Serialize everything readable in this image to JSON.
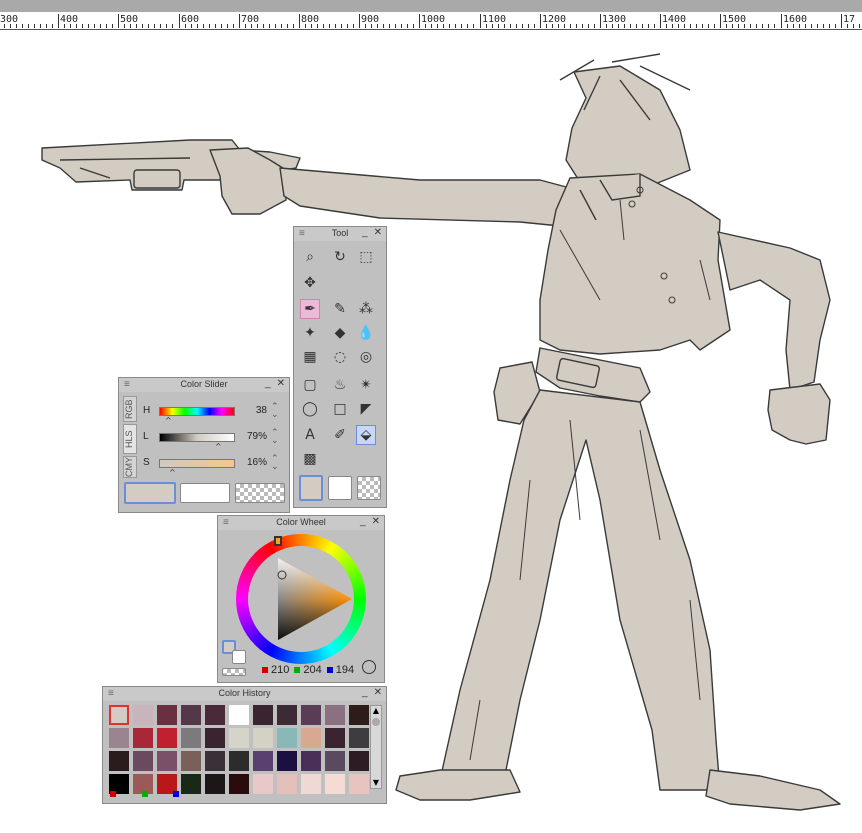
{
  "ruler": {
    "labels": [
      "300",
      "400",
      "500",
      "600",
      "700",
      "800",
      "900",
      "1000",
      "1100",
      "1200",
      "1300",
      "1400",
      "1500",
      "1600",
      "17"
    ]
  },
  "tool_palette": {
    "title": "Tool",
    "tools": [
      {
        "name": "zoom-icon",
        "glyph": "⌕"
      },
      {
        "name": "rotate-view-icon",
        "glyph": "↻"
      },
      {
        "name": "object-select-icon",
        "glyph": "⬚"
      },
      {
        "name": "move-icon",
        "glyph": "✥"
      },
      {
        "name": "pen-icon",
        "glyph": "✒"
      },
      {
        "name": "brush-icon",
        "glyph": "✎"
      },
      {
        "name": "airbrush-icon",
        "glyph": "⁂"
      },
      {
        "name": "decoration-icon",
        "glyph": "✦"
      },
      {
        "name": "eraser-icon",
        "glyph": "◆"
      },
      {
        "name": "blend-icon",
        "glyph": "💧"
      },
      {
        "name": "ruler-tool-icon",
        "glyph": "▦"
      },
      {
        "name": "lasso-icon",
        "glyph": "◌"
      },
      {
        "name": "mesh-icon",
        "glyph": "◎"
      },
      {
        "name": "rect-select-icon",
        "glyph": "▢"
      },
      {
        "name": "cake-icon",
        "glyph": "♨"
      },
      {
        "name": "auto-select-icon",
        "glyph": "✴"
      },
      {
        "name": "ellipse-select-icon",
        "glyph": "◯"
      },
      {
        "name": "frame-icon",
        "glyph": "□"
      },
      {
        "name": "polyline-icon",
        "glyph": "◤"
      },
      {
        "name": "text-icon",
        "glyph": "A"
      },
      {
        "name": "eyedropper-icon",
        "glyph": "✐"
      },
      {
        "name": "fill-icon",
        "glyph": "⬙"
      },
      {
        "name": "gradient-icon",
        "glyph": "▩"
      }
    ]
  },
  "color_slider": {
    "title": "Color Slider",
    "tabs": [
      "RGB",
      "HLS",
      "CMY"
    ],
    "rows": [
      {
        "label": "H",
        "value": "38"
      },
      {
        "label": "L",
        "value": "79%"
      },
      {
        "label": "S",
        "value": "16%"
      }
    ]
  },
  "color_wheel": {
    "title": "Color Wheel",
    "r": "210",
    "g": "204",
    "b": "194"
  },
  "color_history": {
    "title": "Color History",
    "swatches": [
      "#d2ccc2",
      "#c9b3bd",
      "#6a3040",
      "#54384a",
      "#4a2a38",
      "#ffffff",
      "#3a2430",
      "#3c2a34",
      "#5a3c56",
      "#8a7080",
      "#2e1c18",
      "#9a8490",
      "#a82838",
      "#c02030",
      "#7c7a7c",
      "#3a2430",
      "#d4d4c8",
      "#d4d2c4",
      "#8ab8b8",
      "#d8a890",
      "#3a2430",
      "#3e3c3e",
      "#2a1c1c",
      "#6a4a5e",
      "#7a5068",
      "#7a6058",
      "#3a3038",
      "#2c2c2c",
      "#5a4070",
      "#1c1040",
      "#4a3058",
      "#5a4a60",
      "#2e1c24",
      "#000000",
      "#9a5a58",
      "#b81818",
      "#1a2818",
      "#1c1618",
      "#2a0c0c",
      "#e8c8c8",
      "#e4c0bc",
      "#f0d8d4",
      "#f4dcd4",
      "#e8c4c0"
    ]
  },
  "colors": {
    "main": "#d2ccc2",
    "accent_border": "#6b8fd6",
    "panel_bg": "#c0c0c0",
    "title_bg": "#c9c9c9",
    "sketch_fill": "#d2ccc2",
    "sketch_line": "#3a3a3a"
  }
}
